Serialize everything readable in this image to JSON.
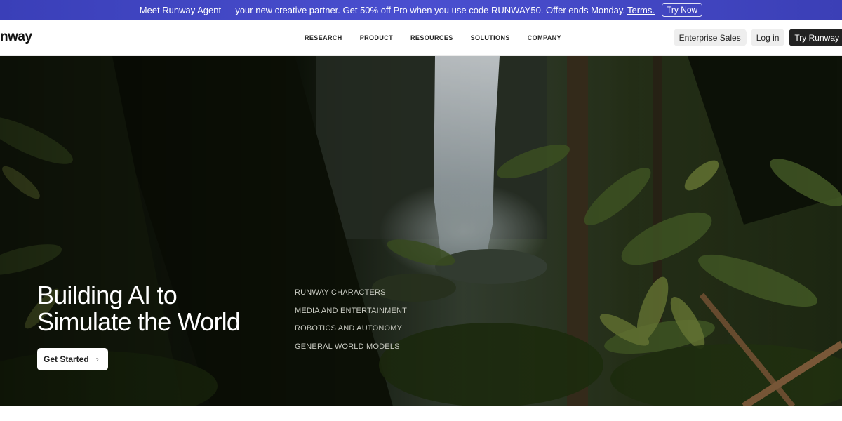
{
  "promo": {
    "text": "Meet Runway Agent — your new creative partner. Get 50% off Pro when you use code RUNWAY50. Offer ends Monday.",
    "terms": "Terms.",
    "button": "Try Now"
  },
  "nav": {
    "logo": "runway",
    "links": [
      "RESEARCH",
      "PRODUCT",
      "RESOURCES",
      "SOLUTIONS",
      "COMPANY"
    ],
    "enterprise": "Enterprise Sales",
    "login": "Log in",
    "try": "Try Runway"
  },
  "hero": {
    "title_line1": "Building AI to",
    "title_line2": "Simulate the World",
    "cta": "Get Started",
    "links": [
      "RUNWAY CHARACTERS",
      "MEDIA AND ENTERTAINMENT",
      "ROBOTICS AND AUTONOMY",
      "GENERAL WORLD MODELS"
    ]
  },
  "icons": {
    "cta_chevron": "chevron-right-icon"
  }
}
